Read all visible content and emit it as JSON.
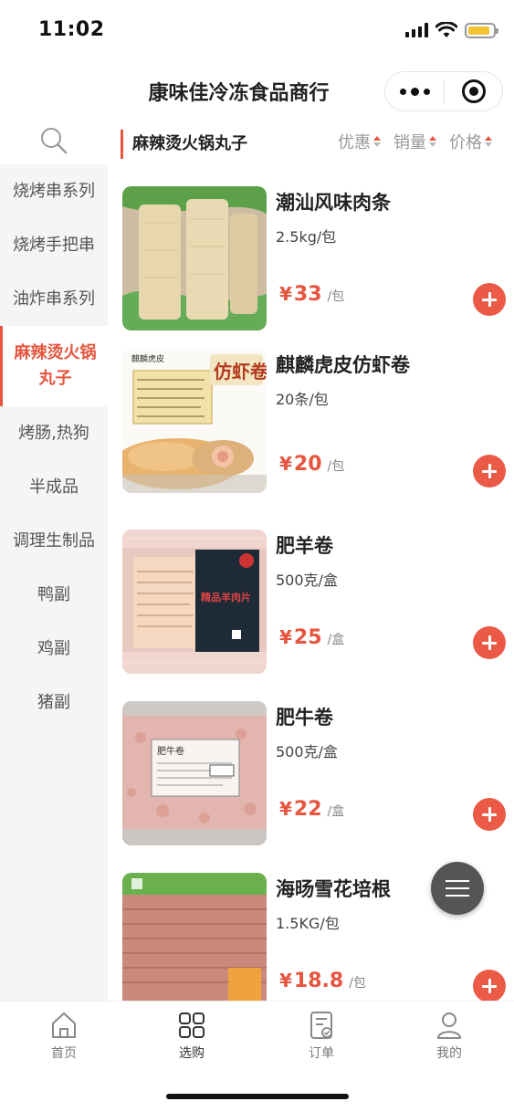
{
  "status_bar": {
    "time": "11:02",
    "battery_level": 0.9,
    "battery_color": "#f2c431"
  },
  "nav": {
    "title": "康味佳冷冻食品商行"
  },
  "sidebar": {
    "search_icon": "search-icon",
    "categories": [
      {
        "label": "烧烤串系列"
      },
      {
        "label": "烧烤手把串"
      },
      {
        "label": "油炸串系列"
      },
      {
        "label": "麻辣烫火锅丸子",
        "active": true
      },
      {
        "label": "烤肠,热狗"
      },
      {
        "label": "半成品"
      },
      {
        "label": "调理生制品"
      },
      {
        "label": "鸭副"
      },
      {
        "label": "鸡副"
      },
      {
        "label": "猪副"
      }
    ]
  },
  "main": {
    "section_title": "麻辣烫火锅丸子",
    "sort_options": [
      {
        "label": "优惠"
      },
      {
        "label": "销量"
      },
      {
        "label": "价格"
      }
    ],
    "products": [
      {
        "name": "潮汕风味肉条",
        "spec": "2.5kg/包",
        "price_symbol": "¥",
        "price": "33",
        "unit": "/包"
      },
      {
        "name": "麒麟虎皮仿虾卷",
        "spec": "20条/包",
        "price_symbol": "¥",
        "price": "20",
        "unit": "/包"
      },
      {
        "name": "肥羊卷",
        "spec": "500克/盒",
        "price_symbol": "¥",
        "price": "25",
        "unit": "/盒"
      },
      {
        "name": "肥牛卷",
        "spec": "500克/盒",
        "price_symbol": "¥",
        "price": "22",
        "unit": "/盒"
      },
      {
        "name": "海旸雪花培根",
        "spec": "1.5KG/包",
        "price_symbol": "¥",
        "price": "18.8",
        "unit": "/包"
      }
    ],
    "image_text": {
      "p2_brand": "麒麟虎皮",
      "p2_badge": "仿虾卷",
      "p3_badge": "精品羊肉片",
      "p4_label": "肥牛卷"
    }
  },
  "tab_bar": {
    "tabs": [
      {
        "label": "首页",
        "icon": "home-icon"
      },
      {
        "label": "选购",
        "icon": "grid-icon",
        "active": true
      },
      {
        "label": "订单",
        "icon": "order-icon"
      },
      {
        "label": "我的",
        "icon": "user-icon"
      }
    ]
  },
  "colors": {
    "accent": "#e5553f",
    "add_button": "#ea5a47",
    "sidebar_bg": "#f5f5f5"
  }
}
